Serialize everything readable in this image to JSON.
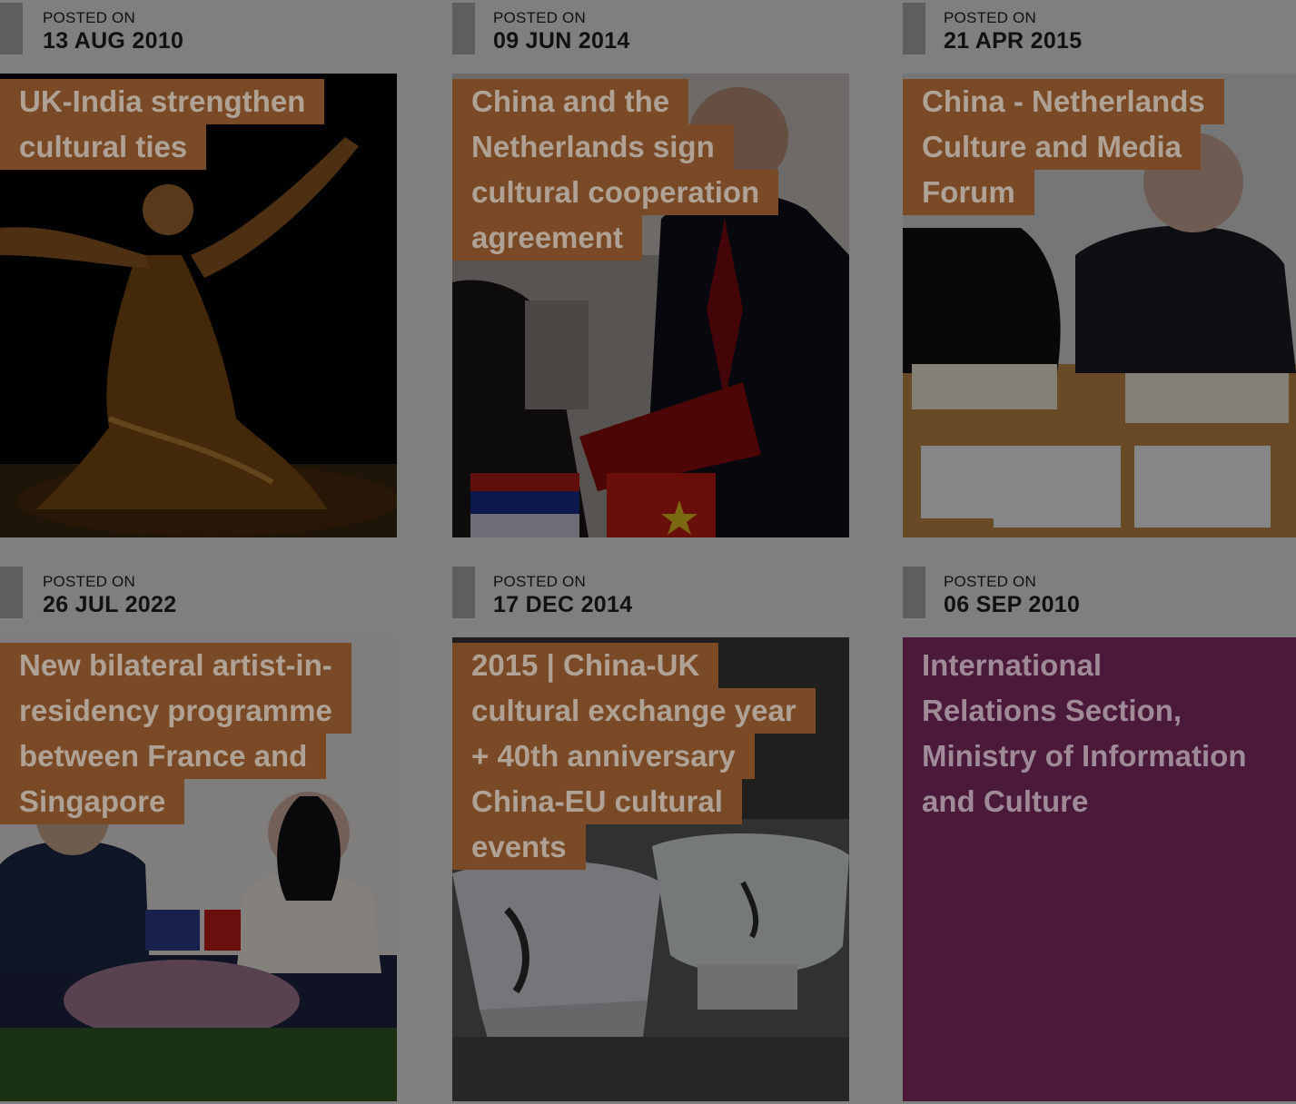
{
  "posted_on_label": "POSTED ON",
  "posts": [
    {
      "date": "13 AUG 2010",
      "title_lines": [
        "UK-India strengthen",
        "cultural ties"
      ],
      "image": "bharatanatyam-dancer-photo"
    },
    {
      "date": "09 JUN 2014",
      "title_lines": [
        "China and the",
        "Netherlands sign",
        "cultural cooperation",
        "agreement"
      ],
      "image": "agreement-signing-handshake-photo"
    },
    {
      "date": "21 APR 2015",
      "title_lines": [
        "China - Netherlands",
        "Culture and Media",
        "Forum"
      ],
      "image": "forum-signing-table-photo"
    },
    {
      "date": "26 JUL 2022",
      "title_lines": [
        "New bilateral artist-in-",
        "residency programme",
        "between France and",
        "Singapore"
      ],
      "image": "france-singapore-signing-photo"
    },
    {
      "date": "17 DEC 2014",
      "title_lines": [
        "2015 | China-UK",
        "cultural exchange year",
        "+ 40th anniversary",
        "China-EU cultural",
        "events"
      ],
      "image": "ceramic-bowls-photo"
    },
    {
      "date": "06 SEP 2010",
      "title_lines": [
        "International",
        "Relations Section,",
        "Ministry of Information",
        "and Culture"
      ],
      "image": ""
    }
  ],
  "colors": {
    "title_tag": "#7a4a26",
    "solid_card": "#4b1a3a",
    "overlay": "#7f7f7f"
  }
}
